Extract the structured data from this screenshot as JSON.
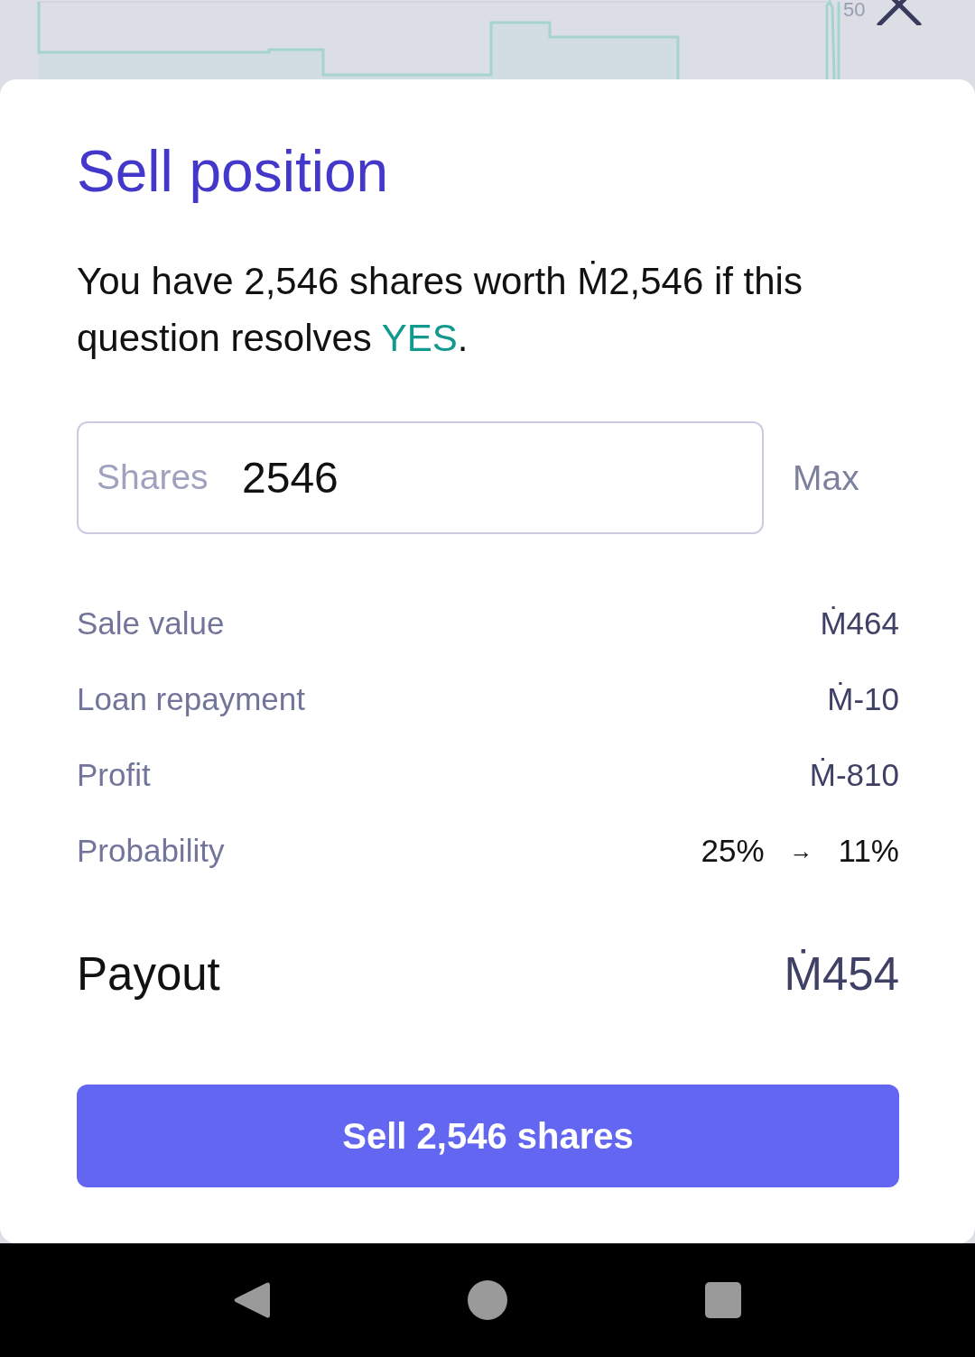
{
  "chart": {
    "tick_label": "50"
  },
  "dialog": {
    "title": "Sell position",
    "message": {
      "before": "You have 2,546 shares worth Ṁ2,546 if this question resolves ",
      "outcome": "YES",
      "after": "."
    },
    "shares_field": {
      "label": "Shares",
      "value": "2546",
      "max_label": "Max"
    },
    "summary": [
      {
        "kind": "amount",
        "label": "Sale value",
        "value": "Ṁ464"
      },
      {
        "kind": "amount",
        "label": "Loan repayment",
        "value": "Ṁ-10"
      },
      {
        "kind": "amount",
        "label": "Profit",
        "value": "Ṁ-810"
      },
      {
        "kind": "change",
        "label": "Probability",
        "from": "25%",
        "arrow": "→",
        "to": "11%"
      }
    ],
    "payout": {
      "label": "Payout",
      "value": "Ṁ454"
    },
    "button": {
      "label": "Sell 2,546 shares"
    }
  }
}
